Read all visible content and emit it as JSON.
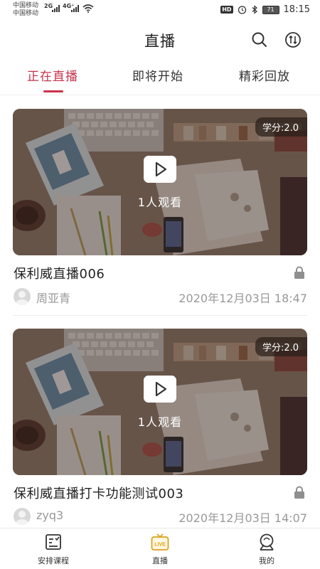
{
  "status_bar": {
    "carrier_1": "中国移动",
    "carrier_2": "中国移动",
    "network_1": "2G",
    "network_2": "4G⁺",
    "hd": "HD",
    "battery": "71",
    "time": "18:15"
  },
  "header": {
    "title": "直播",
    "search_icon": "search-icon",
    "filter_icon": "sort-icon"
  },
  "tabs": [
    {
      "label": "正在直播",
      "active": true
    },
    {
      "label": "即将开始",
      "active": false
    },
    {
      "label": "精彩回放",
      "active": false
    }
  ],
  "courses": [
    {
      "credit": "学分:2.0",
      "viewers": "1人观看",
      "title": "保利威直播006",
      "instructor": "周亚青",
      "datetime": "2020年12月03日 18:47",
      "locked": true
    },
    {
      "credit": "学分:2.0",
      "viewers": "1人观看",
      "title": "保利威直播打卡功能测试003",
      "instructor": "zyq3",
      "datetime": "2020年12月03日 14:07",
      "locked": true
    }
  ],
  "bottom_nav": [
    {
      "label": "安排课程",
      "icon": "schedule-icon",
      "active": false
    },
    {
      "label": "直播",
      "icon": "live-tv-icon",
      "active": true,
      "badge": "LIVE"
    },
    {
      "label": "我的",
      "icon": "profile-icon",
      "active": false
    }
  ],
  "colors": {
    "accent": "#c8334c",
    "live_icon": "#d9a21b",
    "muted_text": "#999999"
  }
}
